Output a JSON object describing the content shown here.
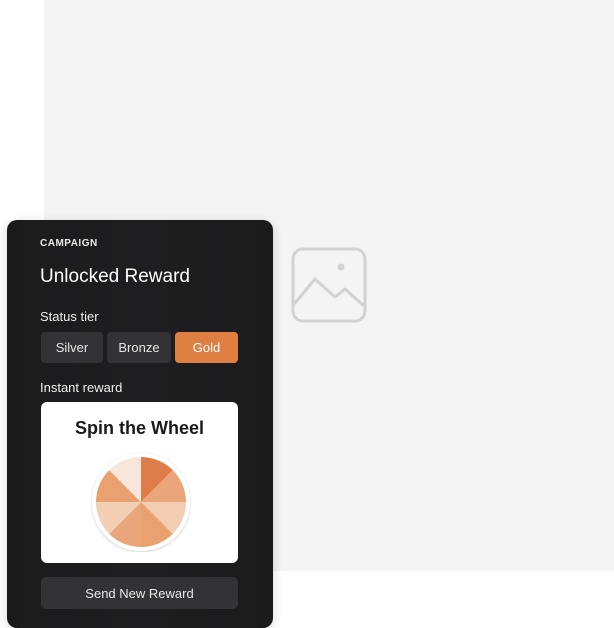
{
  "card": {
    "eyebrow": "CAMPAIGN",
    "title": "Unlocked Reward",
    "tier_label": "Status tier",
    "tiers": [
      {
        "label": "Silver",
        "selected": false
      },
      {
        "label": "Bronze",
        "selected": false
      },
      {
        "label": "Gold",
        "selected": true
      }
    ],
    "instant_label": "Instant reward",
    "reward": {
      "title": "Spin the Wheel",
      "wheel_segment_colors": [
        "#df7d4a",
        "#eba57b",
        "#f3cdb1",
        "#e9a16f",
        "#eba57b",
        "#f2cfb5",
        "#e9a16f",
        "#f8e6da"
      ]
    },
    "send_button": "Send New Reward"
  },
  "colors": {
    "accent": "#e07f42",
    "card_bg": "#1d1d1f",
    "button_bg": "#333336",
    "background_panel": "#f4f4f4"
  },
  "icons": {
    "placeholder": "image-icon"
  }
}
